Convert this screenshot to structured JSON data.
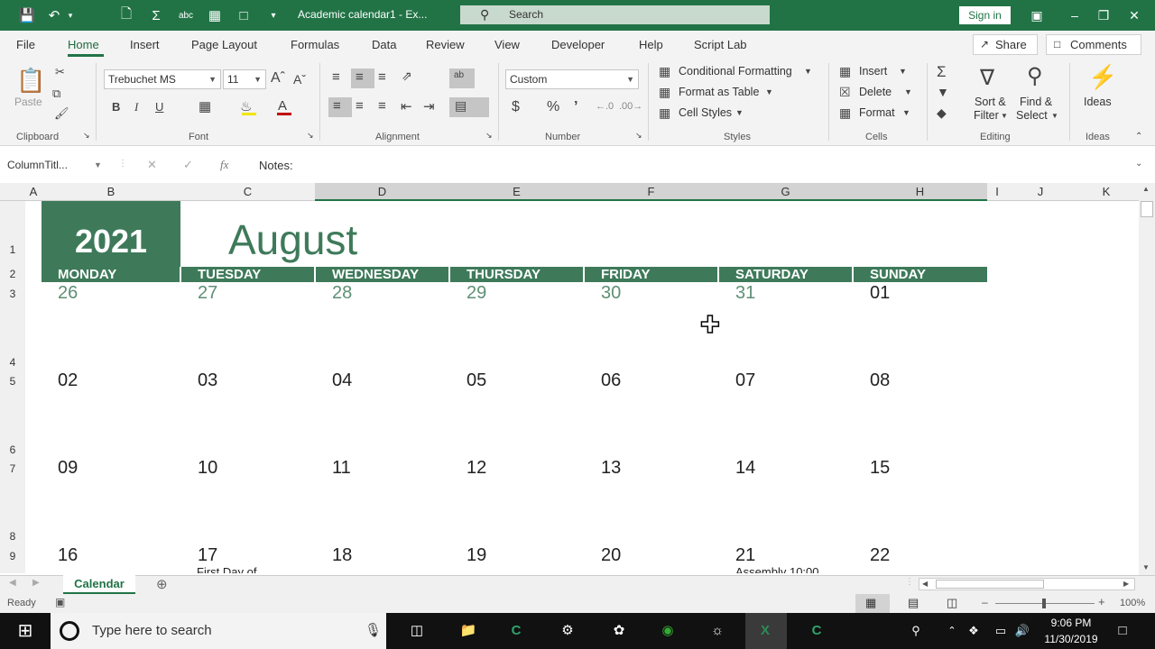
{
  "window": {
    "doc_title": "Academic calendar1 - Ex...",
    "search_placeholder": "Search",
    "sign_in": "Sign in"
  },
  "ribbon_tabs": [
    "File",
    "Home",
    "Insert",
    "Page Layout",
    "Formulas",
    "Data",
    "Review",
    "View",
    "Developer",
    "Help",
    "Script Lab"
  ],
  "ribbon_actions": {
    "share": "Share",
    "comments": "Comments"
  },
  "ribbon": {
    "clipboard": {
      "paste": "Paste",
      "label": "Clipboard"
    },
    "font": {
      "name": "Trebuchet MS",
      "size": "11",
      "label": "Font"
    },
    "alignment": {
      "label": "Alignment"
    },
    "number": {
      "format": "Custom",
      "label": "Number"
    },
    "styles": {
      "conditional": "Conditional Formatting",
      "format_table": "Format as Table",
      "cell_styles": "Cell Styles",
      "label": "Styles"
    },
    "cells": {
      "insert": "Insert",
      "delete": "Delete",
      "format": "Format",
      "label": "Cells"
    },
    "editing": {
      "sort1": "Sort &",
      "sort2": "Filter",
      "find1": "Find &",
      "find2": "Select",
      "label": "Editing"
    },
    "ideas": {
      "button": "Ideas",
      "label": "Ideas"
    }
  },
  "formula_bar": {
    "name_box": "ColumnTitl...",
    "fx": "fx",
    "content": "Notes:"
  },
  "columns": [
    "A",
    "B",
    "C",
    "D",
    "E",
    "F",
    "G",
    "H",
    "I",
    "J",
    "K"
  ],
  "rows": [
    "1",
    "2",
    "3",
    "4",
    "5",
    "6",
    "7",
    "8",
    "9"
  ],
  "calendar": {
    "year": "2021",
    "month": "August",
    "days": [
      "MONDAY",
      "TUESDAY",
      "WEDNESDAY",
      "THURSDAY",
      "FRIDAY",
      "SATURDAY",
      "SUNDAY"
    ],
    "weeks": [
      [
        "26",
        "27",
        "28",
        "29",
        "30",
        "31",
        "01"
      ],
      [
        "02",
        "03",
        "04",
        "05",
        "06",
        "07",
        "08"
      ],
      [
        "09",
        "10",
        "11",
        "12",
        "13",
        "14",
        "15"
      ],
      [
        "16",
        "17",
        "18",
        "19",
        "20",
        "21",
        "22"
      ]
    ],
    "notes": {
      "tue_17": "First Day of",
      "sat_21": "Assembly 10:00"
    }
  },
  "sheet_tab": "Calendar",
  "status": {
    "ready": "Ready",
    "zoom": "100%"
  },
  "taskbar": {
    "search_placeholder": "Type here to search",
    "time": "9:06 PM",
    "date": "11/30/2019"
  },
  "colors": {
    "accent": "#217346",
    "calendar_green": "#3e7a5a"
  }
}
